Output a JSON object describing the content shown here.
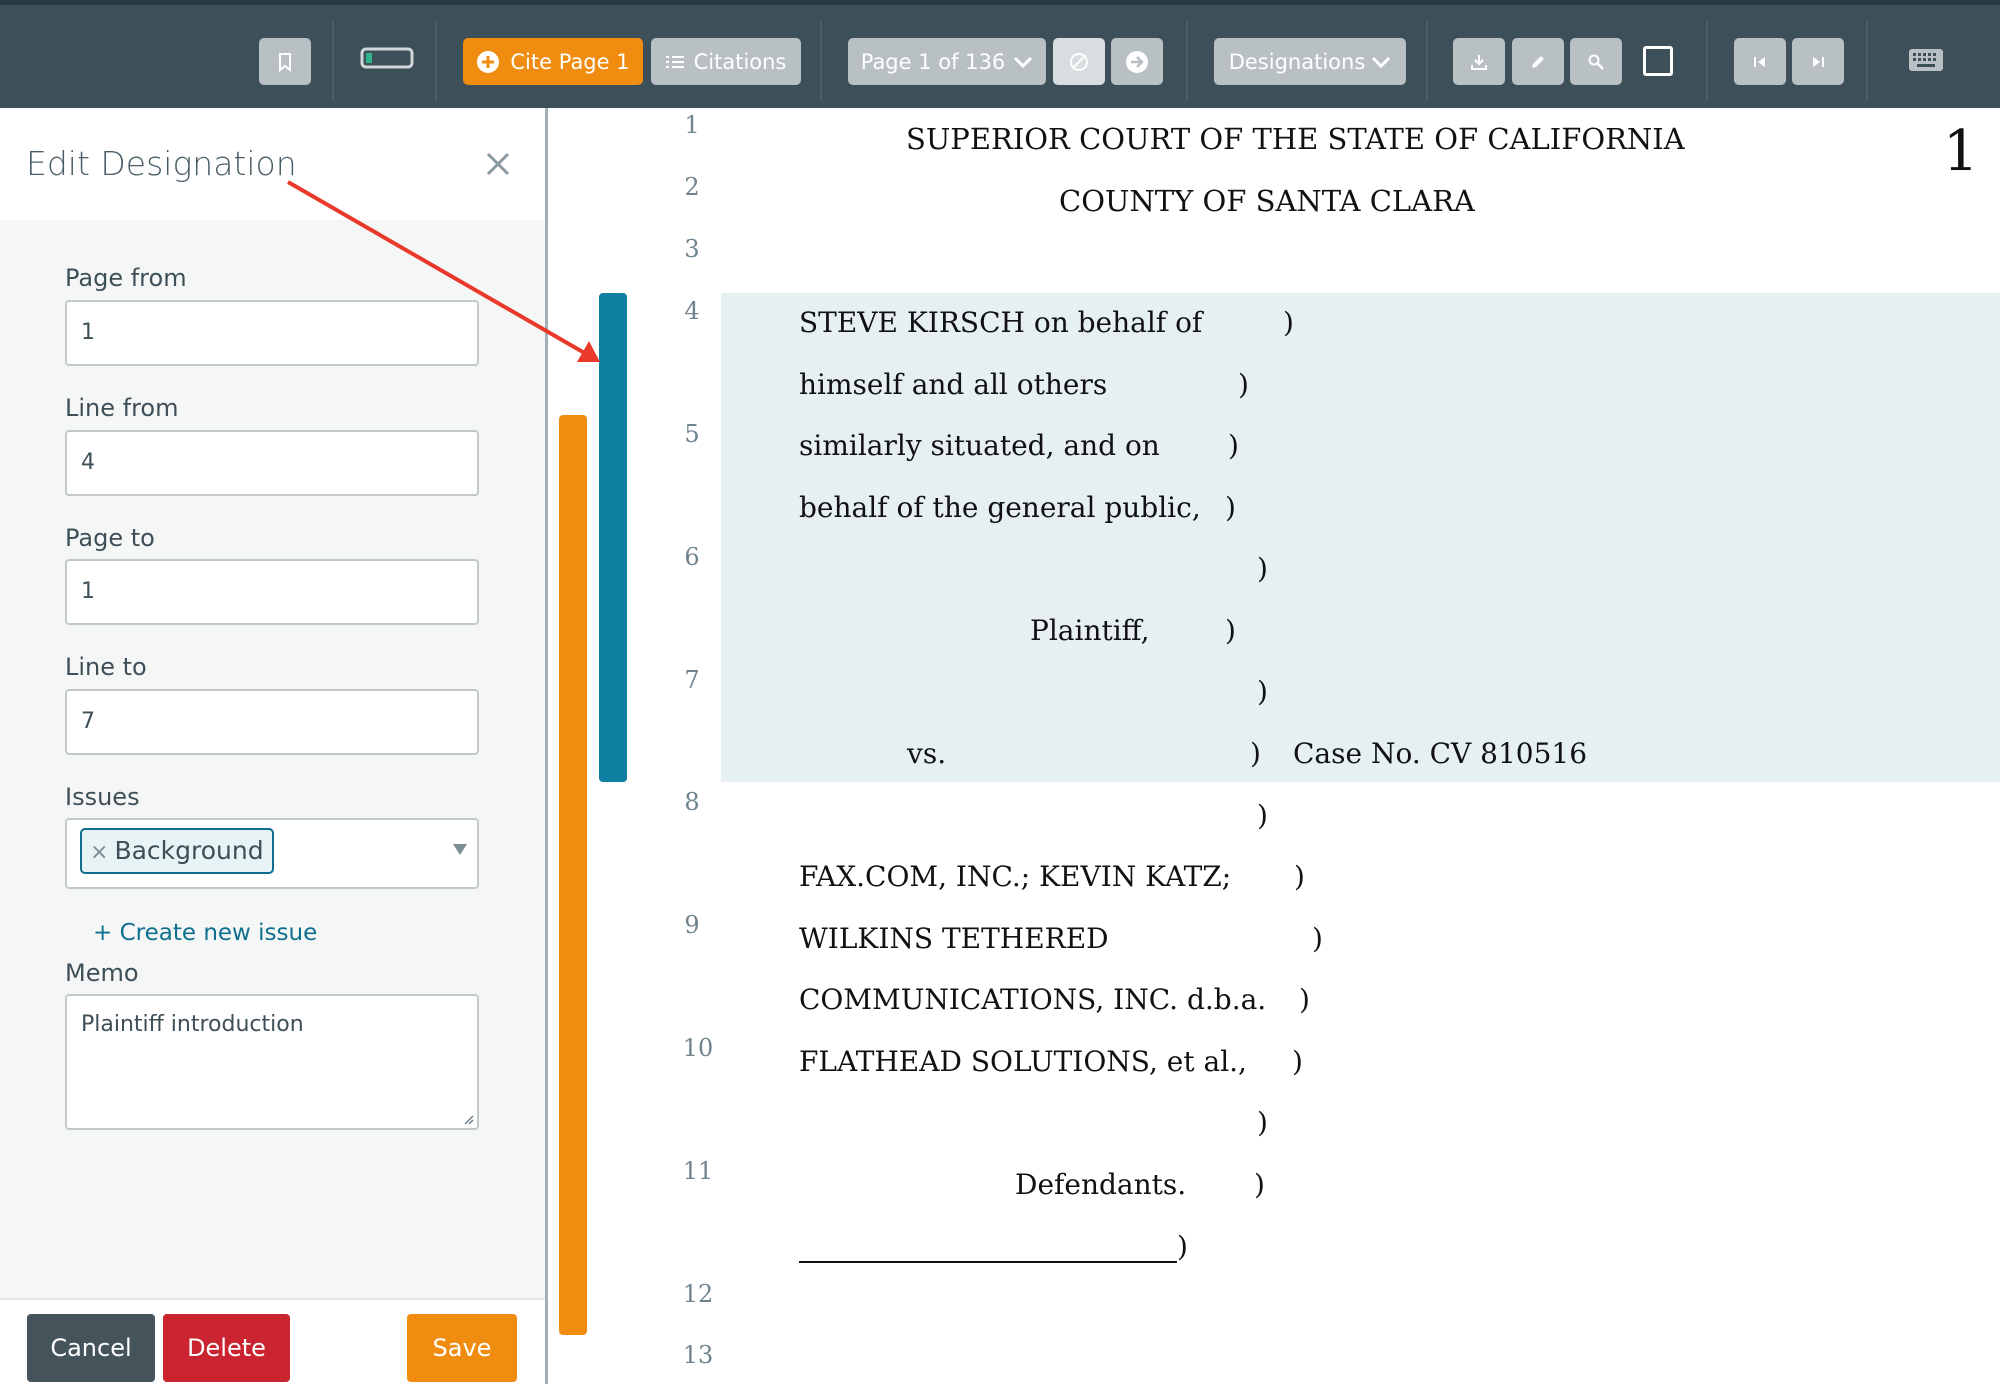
{
  "toolbar": {
    "cite_label": "Cite Page 1",
    "citations_label": "Citations",
    "page_label": "Page 1 of 136",
    "designations_label": "Designations",
    "icons": [
      "bookmark-icon",
      "battery-icon",
      "plus-circle-icon",
      "list-icon",
      "chevron-down-icon",
      "ban-icon",
      "arrow-right-circle-icon",
      "download-icon",
      "pencil-icon",
      "search-icon",
      "square-icon",
      "skip-back-icon",
      "skip-forward-icon",
      "keyboard-icon"
    ]
  },
  "sidebar": {
    "title": "Edit Designation",
    "page_from_label": "Page from",
    "page_from_value": "1",
    "line_from_label": "Line from",
    "line_from_value": "4",
    "page_to_label": "Page to",
    "page_to_value": "1",
    "line_to_label": "Line to",
    "line_to_value": "7",
    "issues_label": "Issues",
    "issue_tag": "Background",
    "create_issue_link": "+ Create new issue",
    "memo_label": "Memo",
    "memo_value": "Plaintiff introduction",
    "cancel_label": "Cancel",
    "delete_label": "Delete",
    "save_label": "Save"
  },
  "document": {
    "page_number": "1",
    "line_numbers": [
      "1",
      "2",
      "3",
      "4",
      "5",
      "6",
      "7",
      "8",
      "9",
      "10",
      "11",
      "12",
      "13"
    ],
    "heading1": "SUPERIOR  COURT  OF  THE  STATE  OF  CALIFORNIA",
    "heading2": "COUNTY  OF  SANTA  CLARA",
    "caption": [
      "STEVE  KIRSCH  on  behalf  of",
      "himself  and  all  others",
      "similarly  situated,  and  on",
      "behalf  of  the  general  public,",
      "Plaintiff,",
      "vs.",
      "Case  No.  CV  810516",
      "FAX.COM,  INC.;  KEVIN  KATZ;",
      "WILKINS  TETHERED",
      "COMMUNICATIONS,  INC.  d.b.a.",
      "FLATHEAD  SOLUTIONS,  et  al.,",
      "Defendants."
    ],
    "paren": ")"
  },
  "colors": {
    "toolbar_bg": "#3d4f58",
    "accent_orange": "#f08c0f",
    "designation_blue": "#0e7ea1",
    "highlight": "#e6f0f2",
    "delete_red": "#c9242f",
    "cancel_gray": "#45545b",
    "annotation_arrow": "#e8392a"
  }
}
